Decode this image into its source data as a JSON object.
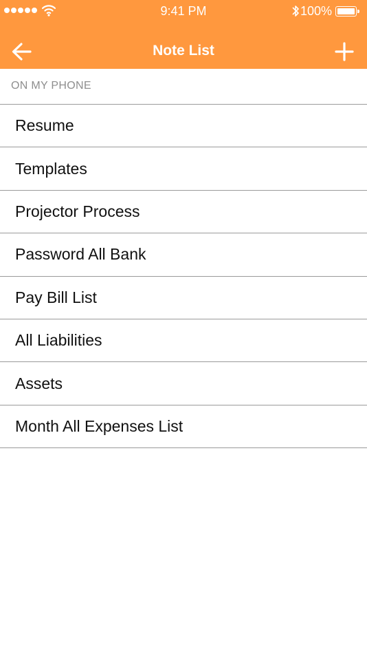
{
  "status_bar": {
    "time": "9:41 PM",
    "battery": "100%",
    "icons": [
      "signal-icon",
      "wifi-icon",
      "bluetooth-icon",
      "battery-icon"
    ]
  },
  "nav": {
    "title": "Note List",
    "back_icon": "arrow-left-icon",
    "add_icon": "plus-icon"
  },
  "colors": {
    "header": "#FF983E",
    "section_text": "#8e8e8e",
    "divider": "#9a9a9a"
  },
  "section": {
    "label": "ON MY PHONE"
  },
  "notes": [
    "Resume",
    "Templates",
    "Projector Process",
    "Password All Bank",
    "Pay Bill List",
    "All Liabilities",
    "Assets",
    "Month All Expenses List"
  ]
}
